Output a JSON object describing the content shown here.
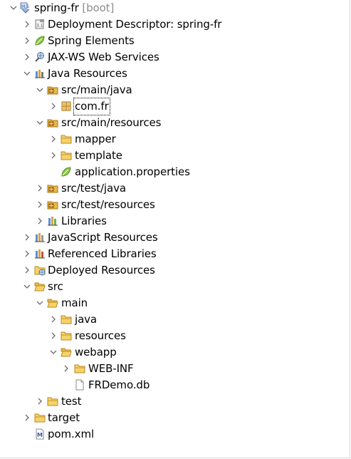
{
  "project_explorer": {
    "project": {
      "name": "spring-fr",
      "suffix": "[boot]"
    },
    "items": {
      "deployment_descriptor": "Deployment Descriptor: spring-fr",
      "spring_elements": "Spring Elements",
      "jaxws_web_services": "JAX-WS Web Services",
      "java_resources": "Java Resources",
      "src_main_java": "src/main/java",
      "com_fr": "com.fr",
      "src_main_resources": "src/main/resources",
      "mapper": "mapper",
      "template": "template",
      "application_properties": "application.properties",
      "src_test_java": "src/test/java",
      "src_test_resources": "src/test/resources",
      "libraries": "Libraries",
      "javascript_resources": "JavaScript Resources",
      "referenced_libraries": "Referenced Libraries",
      "deployed_resources": "Deployed Resources",
      "src": "src",
      "main": "main",
      "java": "java",
      "resources": "resources",
      "webapp": "webapp",
      "web_inf": "WEB-INF",
      "frdemo_db": "FRDemo.db",
      "test": "test",
      "target": "target",
      "pom_xml": "pom.xml"
    },
    "colors": {
      "folder": "#e8b949",
      "package_folder": "#c98a2a",
      "spring_leaf": "#6db33f",
      "twisty": "#6b6b6b",
      "decorator_suffix": "#8c8c8c"
    }
  }
}
